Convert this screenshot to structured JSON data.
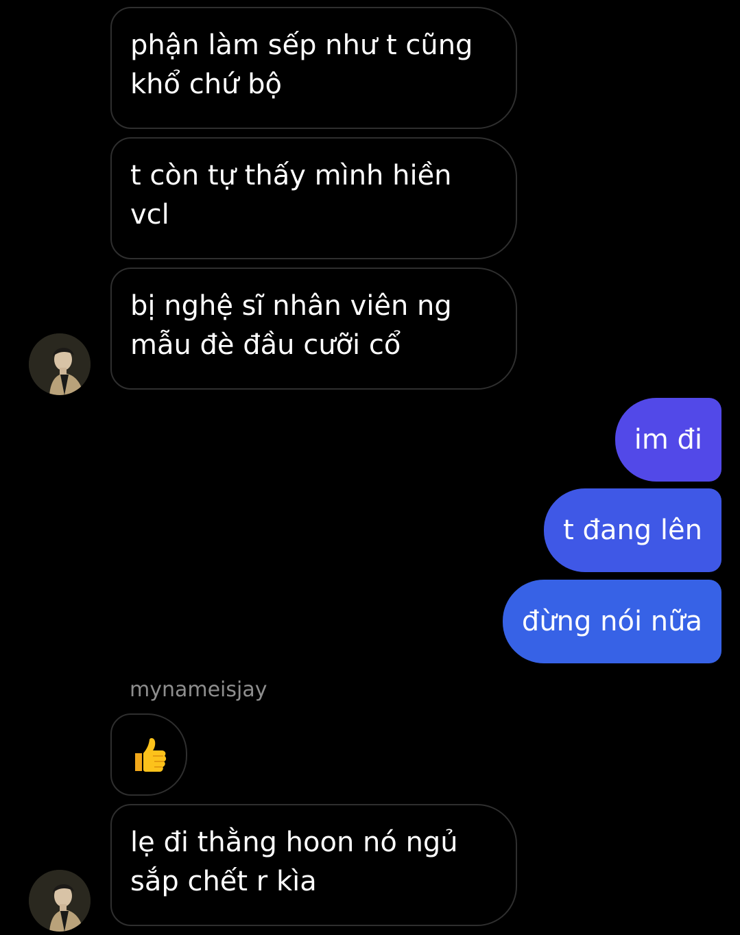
{
  "thread": {
    "incoming_group_1": [
      {
        "text": "phận làm sếp như t cũng khổ chứ bộ"
      },
      {
        "text": "t còn tự thấy mình hiền vcl"
      },
      {
        "text": "bị nghệ sĩ nhân viên ng mẫu đè đầu cưỡi cổ"
      }
    ],
    "outgoing": [
      {
        "text": "im đi"
      },
      {
        "text": "t đang lên"
      },
      {
        "text": "đừng nói nữa"
      }
    ],
    "sender_name": "mynameisjay",
    "reaction_icon": "thumbs-up-emoji",
    "incoming_group_2": [
      {
        "text": "lẹ đi thằng hoon nó ngủ sắp chết r kìa"
      }
    ]
  },
  "colors": {
    "background": "#000000",
    "incoming_border": "#2f2f2f",
    "outgoing_top": "#5249e8",
    "outgoing_mid": "#3f58e6",
    "outgoing_bottom": "#3762e6",
    "sender_name": "#8e8e8e",
    "text": "#ffffff"
  }
}
